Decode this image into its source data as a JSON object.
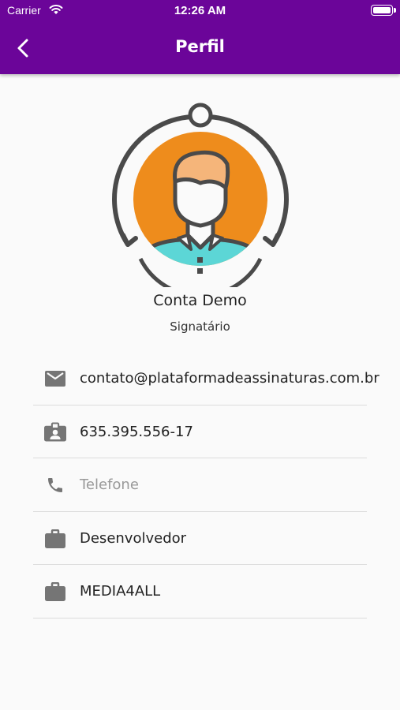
{
  "status_bar": {
    "carrier": "Carrier",
    "time": "12:26 AM"
  },
  "header": {
    "title": "Perfil",
    "back_icon": "chevron-left-icon",
    "background": "#6b0599"
  },
  "profile": {
    "name": "Conta Demo",
    "role": "Signatário",
    "avatar_colors": {
      "circle": "#ee8c1c",
      "shirt": "#5cd6d6",
      "outline": "#4a4a4a"
    }
  },
  "info": {
    "email": "contato@plataformadeassinaturas.com.br",
    "document": "635.395.556-17",
    "phone_placeholder": "Telefone",
    "position": "Desenvolvedor",
    "company": "MEDIA4ALL"
  }
}
